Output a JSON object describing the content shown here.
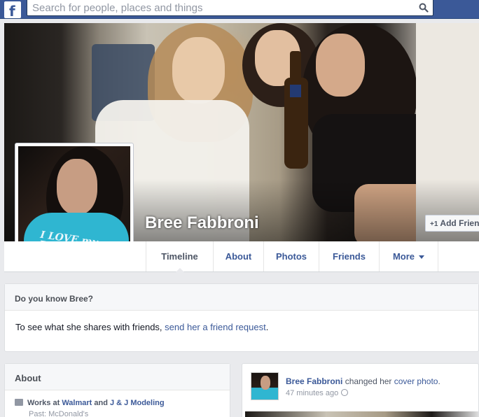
{
  "topbar": {
    "logo": "f",
    "search_placeholder": "Search for people, places and things"
  },
  "profile": {
    "name": "Bree Fabbroni",
    "add_friend_label": "Add Friend",
    "avatar_shirt_text": "I LOVE my BOYFRIEND"
  },
  "nav": {
    "tabs": [
      {
        "label": "Timeline"
      },
      {
        "label": "About"
      },
      {
        "label": "Photos"
      },
      {
        "label": "Friends"
      },
      {
        "label": "More"
      }
    ]
  },
  "know": {
    "heading": "Do you know Bree?",
    "text": "To see what she shares with friends, ",
    "link": "send her a friend request",
    "tail": "."
  },
  "about": {
    "heading": "About",
    "works_prefix": "Works at ",
    "employer1": "Walmart",
    "and": " and ",
    "employer2": "J & J Modeling",
    "past": "Past: McDonald's"
  },
  "story": {
    "author": "Bree Fabbroni",
    "action": " changed her ",
    "object": "cover photo",
    "period": ".",
    "time": "47 minutes ago"
  }
}
